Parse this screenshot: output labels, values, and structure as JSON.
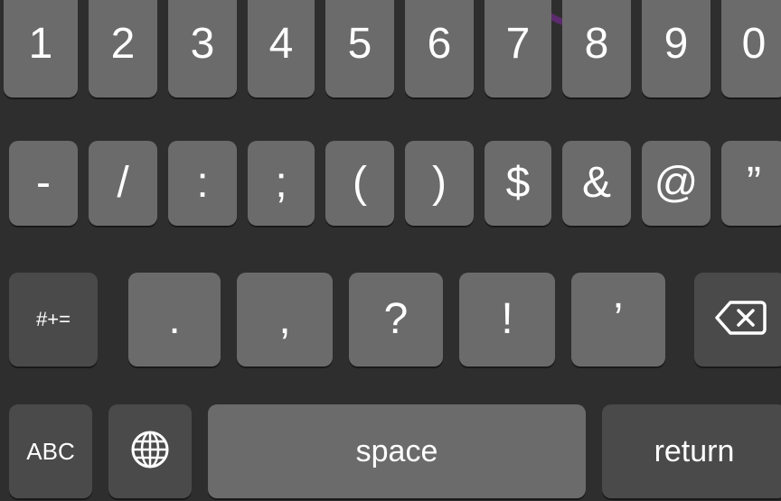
{
  "colors": {
    "background": "#2e2e2e",
    "key": "#6b6b6b",
    "function_key": "#4a4a4a",
    "text": "#ffffff",
    "accent": "#5c2a6e"
  },
  "rows": {
    "numbers": [
      "1",
      "2",
      "3",
      "4",
      "5",
      "6",
      "7",
      "8",
      "9",
      "0"
    ],
    "symbols": [
      "-",
      "/",
      ":",
      ";",
      "(",
      ")",
      "$",
      "&",
      "@",
      "”"
    ],
    "punctuation": [
      ".",
      ",",
      "?",
      "!",
      "’"
    ]
  },
  "keys": {
    "more_symbols": "#+=",
    "abc": "ABC",
    "space": "space",
    "return": "return",
    "delete_icon": "delete-icon",
    "globe_icon": "globe-icon"
  }
}
